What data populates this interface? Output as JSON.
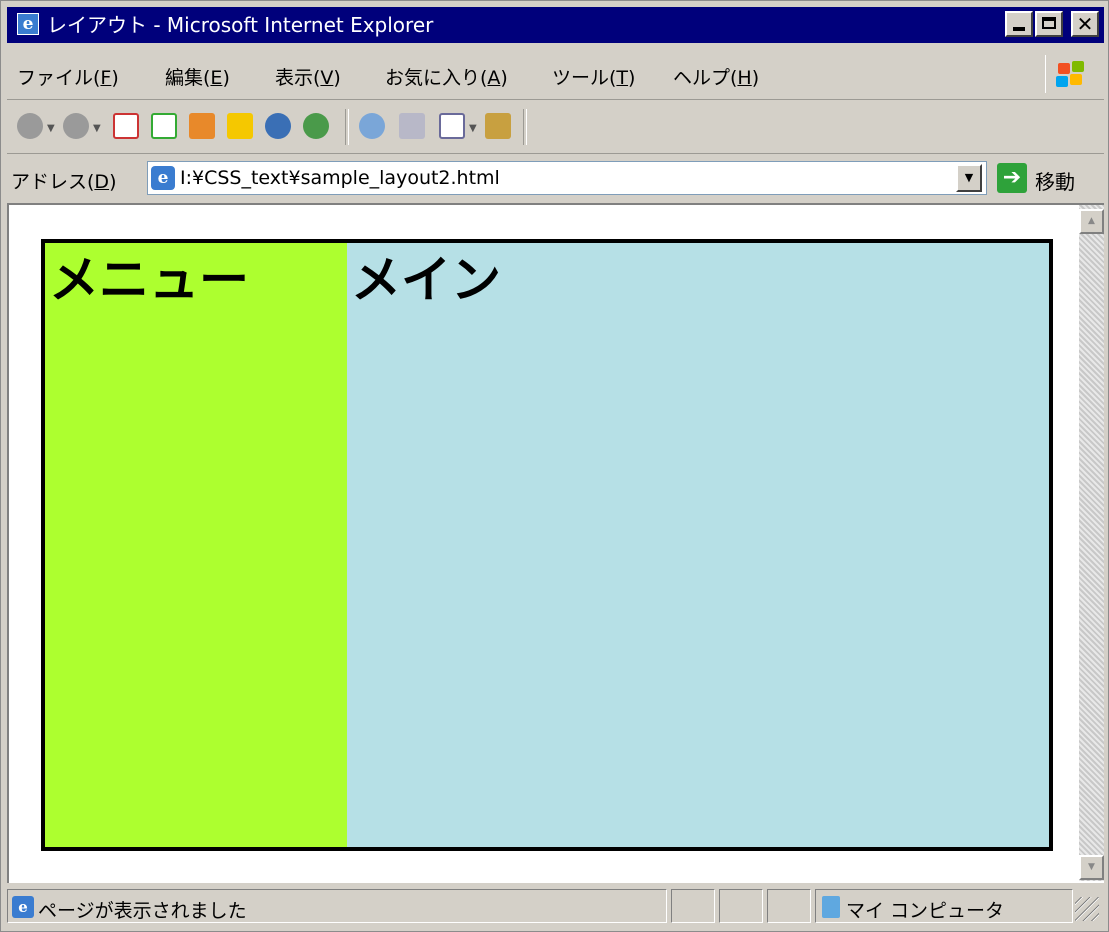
{
  "window": {
    "title": "レイアウト - Microsoft Internet Explorer",
    "close_glyph": "✕"
  },
  "menubar": {
    "items": [
      {
        "label": "ファイル(",
        "key": "F",
        "end": ")"
      },
      {
        "label": "編集(",
        "key": "E",
        "end": ")"
      },
      {
        "label": "表示(",
        "key": "V",
        "end": ")"
      },
      {
        "label": "お気に入り(",
        "key": "A",
        "end": ")"
      },
      {
        "label": "ツール(",
        "key": "T",
        "end": ")"
      },
      {
        "label": "ヘルプ(",
        "key": "H",
        "end": ")"
      }
    ]
  },
  "toolbar": {
    "buttons": [
      "back-icon",
      "forward-icon",
      "stop-icon",
      "refresh-icon",
      "home-icon",
      "favorites-icon",
      "media-icon",
      "history-icon",
      "search-icon",
      "print-icon",
      "edit-icon",
      "messenger-icon"
    ]
  },
  "addressbar": {
    "label": "アドレス(",
    "label_key": "D",
    "label_end": ")",
    "url": "I:¥CSS_text¥sample_layout2.html",
    "go_label": "移動",
    "dropdown_glyph": "▼",
    "go_glyph": "➔"
  },
  "page": {
    "menu_heading": "メニュー",
    "main_heading": "メイン",
    "colors": {
      "menu_bg": "#adff2f",
      "main_bg": "#b6e0e6",
      "border": "#000000"
    }
  },
  "statusbar": {
    "message": "ページが表示されました",
    "zone": "マイ コンピュータ"
  }
}
